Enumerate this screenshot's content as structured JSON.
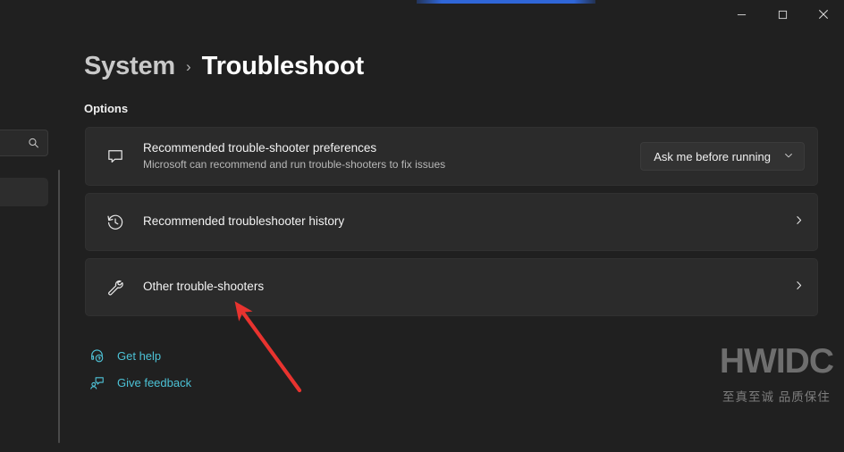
{
  "window": {
    "controls": [
      {
        "name": "minimize-button",
        "label": "Minimize",
        "icon": "minimize-icon"
      },
      {
        "name": "maximize-button",
        "label": "Maximize",
        "icon": "maximize-icon"
      },
      {
        "name": "close-button",
        "label": "Close",
        "icon": "close-icon"
      }
    ],
    "accent_color": "#2f66d8"
  },
  "sidebar": {
    "search_placeholder": "",
    "search_icon": "search-icon",
    "selected_item_label": ""
  },
  "breadcrumb": {
    "parent": "System",
    "separator": "›",
    "current": "Troubleshoot"
  },
  "main": {
    "section_label": "Options",
    "cards": [
      {
        "icon": "feedback-bubble-icon",
        "title": "Recommended trouble-shooter preferences",
        "subtitle": "Microsoft can recommend and run trouble-shooters to fix issues",
        "control": "dropdown",
        "dropdown_value": "Ask me before running",
        "dropdown_icon": "chevron-down-icon"
      },
      {
        "icon": "history-clock-icon",
        "title": "Recommended troubleshooter history",
        "subtitle": "",
        "control": "chevron",
        "chevron_icon": "chevron-right-icon"
      },
      {
        "icon": "wrench-icon",
        "title": "Other trouble-shooters",
        "subtitle": "",
        "control": "chevron",
        "chevron_icon": "chevron-right-icon"
      }
    ],
    "links": [
      {
        "icon": "get-help-icon",
        "label": "Get help"
      },
      {
        "icon": "give-feedback-icon",
        "label": "Give feedback"
      }
    ],
    "link_color": "#4cc2d6"
  },
  "watermark": {
    "main": "HWIDC",
    "sub": "至真至诚 品质保住"
  },
  "annotation": {
    "arrow_color": "#e8332f",
    "description": "red arrow pointing to Other trouble-shooters"
  }
}
